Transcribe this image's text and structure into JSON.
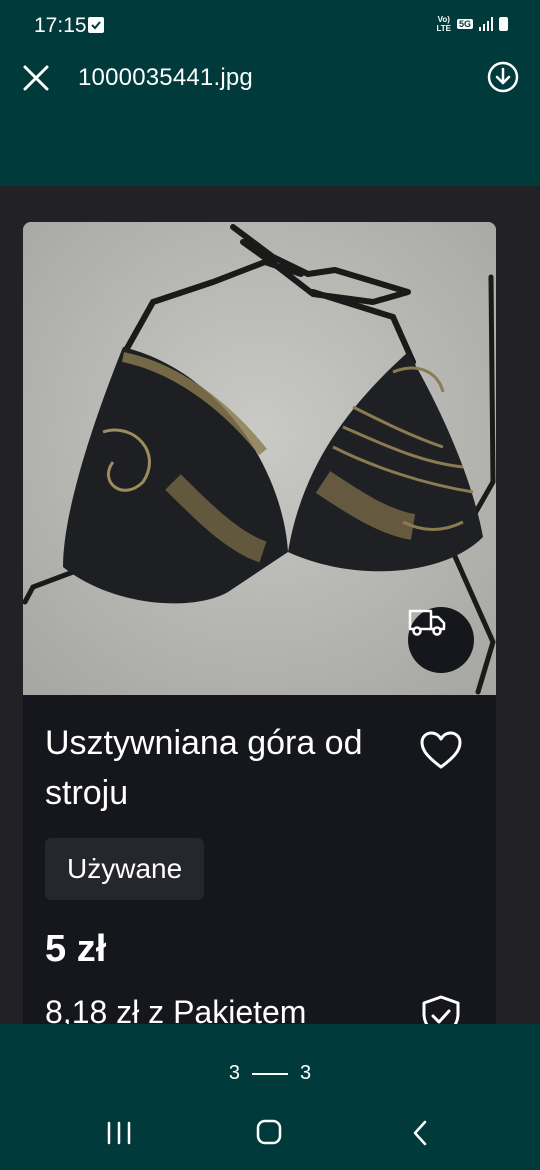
{
  "status": {
    "time": "17:15",
    "volte": "Vo)\nLTE",
    "network": "5G"
  },
  "appbar": {
    "filename": "1000035441.jpg"
  },
  "listing": {
    "title": "Usztywniana góra od stroju",
    "condition": "Używane",
    "price": "5 zł",
    "price_with_protection": "8,18 zł z Pakietem"
  },
  "pager": {
    "current": "3",
    "total": "3"
  },
  "colors": {
    "system_bar": "#003a3a",
    "card": "#16171c",
    "viewer_bg": "#222226"
  }
}
